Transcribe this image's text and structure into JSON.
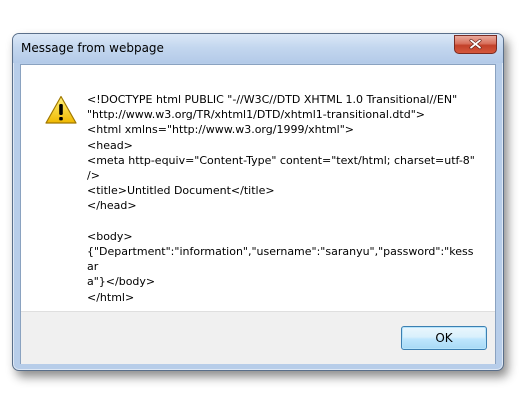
{
  "dialog": {
    "title": "Message from webpage",
    "icon": "warning-icon",
    "message_lines": [
      "<!DOCTYPE html PUBLIC \"-//W3C//DTD XHTML 1.0 Transitional//EN\"",
      "\"http://www.w3.org/TR/xhtml1/DTD/xhtml1-transitional.dtd\">",
      "<html xmlns=\"http://www.w3.org/1999/xhtml\">",
      "<head>",
      "<meta http-equiv=\"Content-Type\" content=\"text/html; charset=utf-8\"",
      "/>",
      "<title>Untitled Document</title>",
      "</head>",
      "",
      "<body>",
      "{\"Department\":\"information\",\"username\":\"saranyu\",\"password\":\"kessar",
      "a\"}</body>",
      "</html>"
    ],
    "ok_label": "OK"
  },
  "colors": {
    "title_bar": "#c4d7ef",
    "close_button": "#c94a31",
    "warning_yellow": "#f5c400",
    "footer_background": "#f0f0f0",
    "ok_button_border": "#3c7fb1"
  }
}
